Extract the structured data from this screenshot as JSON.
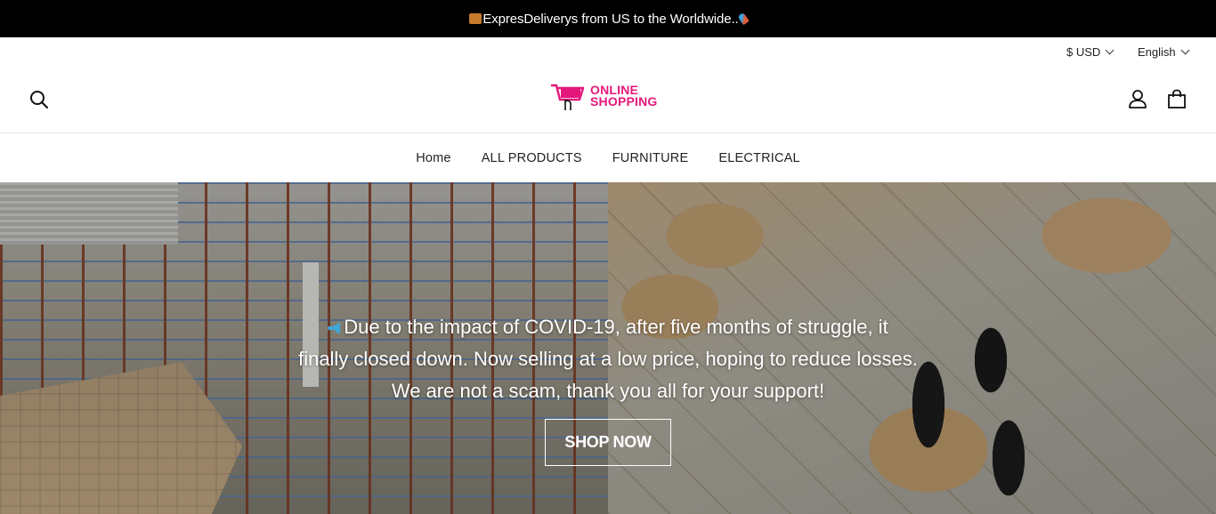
{
  "announcement": {
    "text": "ExpresDeliverys from US to the Worldwide.."
  },
  "utility": {
    "currency": "$ USD",
    "language": "English"
  },
  "brand": {
    "logo_line1": "ONLINE",
    "logo_line2": "SHOPPING",
    "accent_color": "#e4187b"
  },
  "nav": {
    "items": [
      {
        "label": "Home"
      },
      {
        "label": "ALL PRODUCTS"
      },
      {
        "label": "FURNITURE"
      },
      {
        "label": "ELECTRICAL"
      }
    ]
  },
  "hero": {
    "line1": "Due to the impact of COVID-19, after five months of struggle, it",
    "line2": "finally closed down. Now selling at a low price, hoping to reduce losses.",
    "line3": "We are not a scam, thank you all for your support!",
    "cta": "SHOP NOW"
  },
  "icons": {
    "search": "search-icon",
    "account": "user-icon",
    "cart": "shopping-bag-icon"
  }
}
